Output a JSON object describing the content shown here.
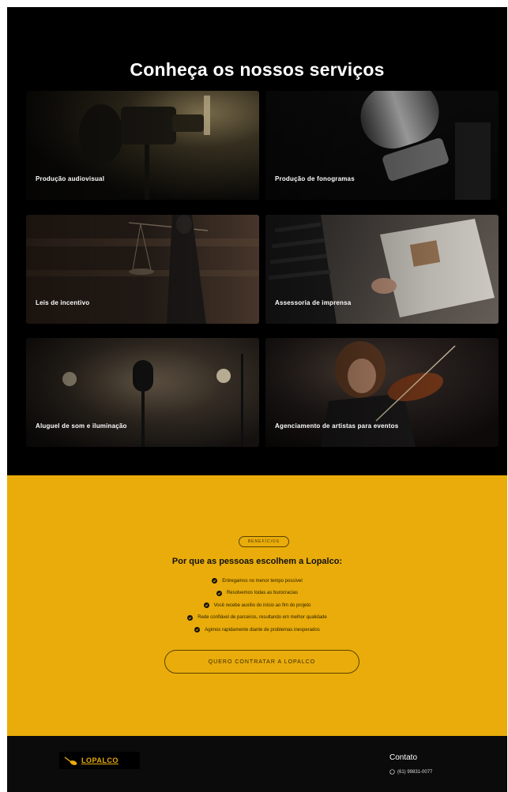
{
  "services": {
    "title": "Conheça os nossos serviços",
    "cards": [
      {
        "label": "Produção audiovisual"
      },
      {
        "label": "Produção de fonogramas"
      },
      {
        "label": "Leis de incentivo"
      },
      {
        "label": "Assessoria de imprensa"
      },
      {
        "label": "Aluguel de som e iluminação"
      },
      {
        "label": "Agenciamento de artistas para eventos"
      }
    ]
  },
  "benefits": {
    "badge": "BENEFÍCIOS",
    "title": "Por que as pessoas escolhem a Lopalco:",
    "items": [
      "Entregamos no menor tempo possível",
      "Resolvemos todas as burocracias",
      "Você recebe auxílio do início ao fim do projeto",
      "Rede confiável de parceiros, resultando em melhor qualidade",
      "Agimos rapidamente diante de problemas inesperados"
    ],
    "cta": "QUERO CONTRATAR A LOPALCO",
    "background": "#e9ac0a"
  },
  "footer": {
    "logo_text": "LOPALCO",
    "contact_title": "Contato",
    "phone": "(61) 99831-0077"
  }
}
